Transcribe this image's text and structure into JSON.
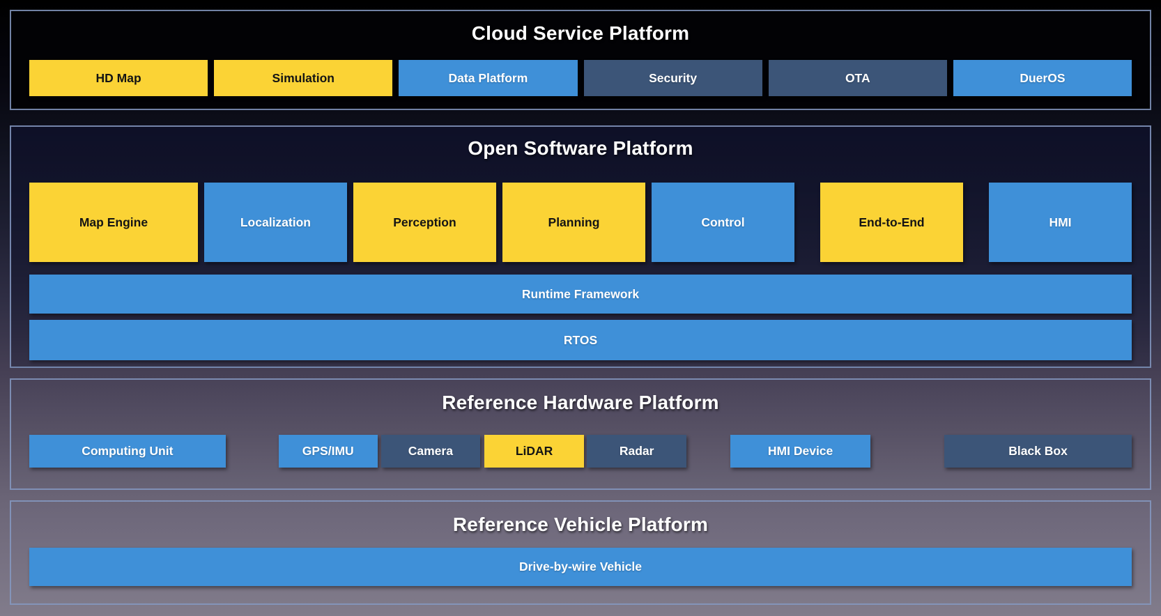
{
  "colors": {
    "yellow": "#FBD335",
    "bright_blue": "#3F90D8",
    "slate_blue": "#3C5578",
    "section_border": "#8599C2",
    "background_top": "#000000",
    "background_bottom": "#817C8B"
  },
  "cloud_platform": {
    "title": "Cloud Service Platform",
    "items": [
      {
        "label": "HD Map",
        "color": "yellow"
      },
      {
        "label": "Simulation",
        "color": "yellow"
      },
      {
        "label": "Data Platform",
        "color": "bright_blue"
      },
      {
        "label": "Security",
        "color": "slate_blue"
      },
      {
        "label": "OTA",
        "color": "slate_blue"
      },
      {
        "label": "DuerOS",
        "color": "bright_blue"
      }
    ]
  },
  "software_platform": {
    "title": "Open Software Platform",
    "modules": [
      {
        "label": "Map Engine",
        "color": "yellow"
      },
      {
        "label": "Localization",
        "color": "bright_blue"
      },
      {
        "label": "Perception",
        "color": "yellow"
      },
      {
        "label": "Planning",
        "color": "yellow"
      },
      {
        "label": "Control",
        "color": "bright_blue"
      },
      {
        "label": "End-to-End",
        "color": "yellow"
      },
      {
        "label": "HMI",
        "color": "bright_blue"
      }
    ],
    "bars": [
      {
        "label": "Runtime Framework",
        "color": "bright_blue"
      },
      {
        "label": "RTOS",
        "color": "bright_blue"
      }
    ]
  },
  "hardware_platform": {
    "title": "Reference Hardware Platform",
    "items": [
      {
        "label": "Computing Unit",
        "color": "bright_blue"
      },
      {
        "label": "GPS/IMU",
        "color": "bright_blue"
      },
      {
        "label": "Camera",
        "color": "slate_blue"
      },
      {
        "label": "LiDAR",
        "color": "yellow"
      },
      {
        "label": "Radar",
        "color": "slate_blue"
      },
      {
        "label": "HMI Device",
        "color": "bright_blue"
      },
      {
        "label": "Black Box",
        "color": "slate_blue"
      }
    ]
  },
  "vehicle_platform": {
    "title": "Reference Vehicle Platform",
    "bar": {
      "label": "Drive-by-wire Vehicle",
      "color": "bright_blue"
    }
  }
}
